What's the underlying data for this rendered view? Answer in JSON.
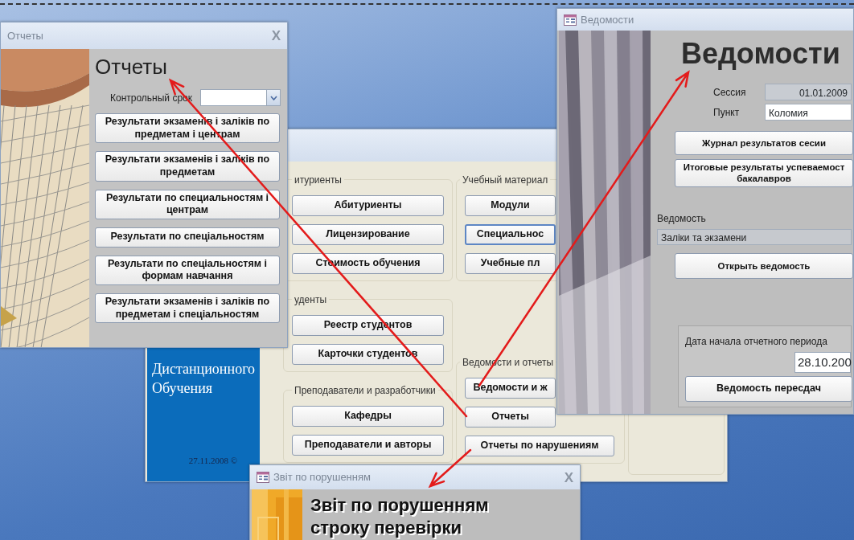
{
  "main_window": {
    "sidebar": {
      "lines": [
        "Дистанционного",
        "Обучения"
      ],
      "date": "27.11.2008 ©"
    },
    "columns": [
      {
        "groups": [
          {
            "title": "итуриенты",
            "buttons": [
              {
                "label": "Абитуриенты",
                "focused": false
              },
              {
                "label": "Лицензирование",
                "focused": false
              },
              {
                "label": "Стоимость обучения",
                "focused": false
              }
            ]
          },
          {
            "title": "уденты",
            "buttons": [
              {
                "label": "Реестр студентов",
                "focused": false
              },
              {
                "label": "Карточки студентов",
                "focused": false
              }
            ]
          },
          {
            "title": "Преподаватели и разработчики",
            "buttons": [
              {
                "label": "Кафедры",
                "focused": false
              },
              {
                "label": "Преподаватели и авторы",
                "focused": false
              }
            ]
          }
        ]
      },
      {
        "groups": [
          {
            "title": "Учебный материал",
            "buttons": [
              {
                "label": "Модули",
                "focused": false
              },
              {
                "label": "Специальнос",
                "focused": true
              },
              {
                "label": "Учебные пл",
                "focused": false
              }
            ]
          },
          {
            "title": "Ведомости и отчеты",
            "buttons": [
              {
                "label": "Ведомости и ж",
                "focused": false
              },
              {
                "label": "Отчеты",
                "focused": false
              },
              {
                "label": "Отчеты по нарушениям",
                "focused": false
              }
            ]
          }
        ]
      }
    ]
  },
  "reports_window": {
    "title": "Отчеты",
    "close_label": "X",
    "heading": "Отчеты",
    "period_label": "Контрольный срок",
    "buttons": [
      "Результати экзаменів і заліків по предметам і центрам",
      "Результати экзаменів і заліків по предметам",
      "Результати  по специальностям і центрам",
      "Результати по спеціальностям",
      "Результати по спеціальностям і формам навчання",
      "Результати экзаменів і заліків по предметам і спеціальностям"
    ]
  },
  "statements_window": {
    "title": "Ведомости",
    "heading": "Ведомости",
    "fields": [
      {
        "label": "Сессия",
        "value": "01.01.2009",
        "kind": "readonly"
      },
      {
        "label": "Пункт",
        "value": "Коломия",
        "kind": "text"
      }
    ],
    "buttons": [
      "Журнал результатов сесии",
      "Итоговые результаты успеваемост\nбакалавров"
    ],
    "statement_label": "Ведомость",
    "statement_value": "Заліки та экзамени",
    "open_button": "Открыть ведомость",
    "period": {
      "label": "Дата начала отчетного периода",
      "value": "28.10.200",
      "button": "Ведомость пересдач"
    }
  },
  "violations_window": {
    "title": "Звіт по порушенням",
    "close_label": "X",
    "heading": "Звіт по порушенням\nстроку перевірки"
  }
}
